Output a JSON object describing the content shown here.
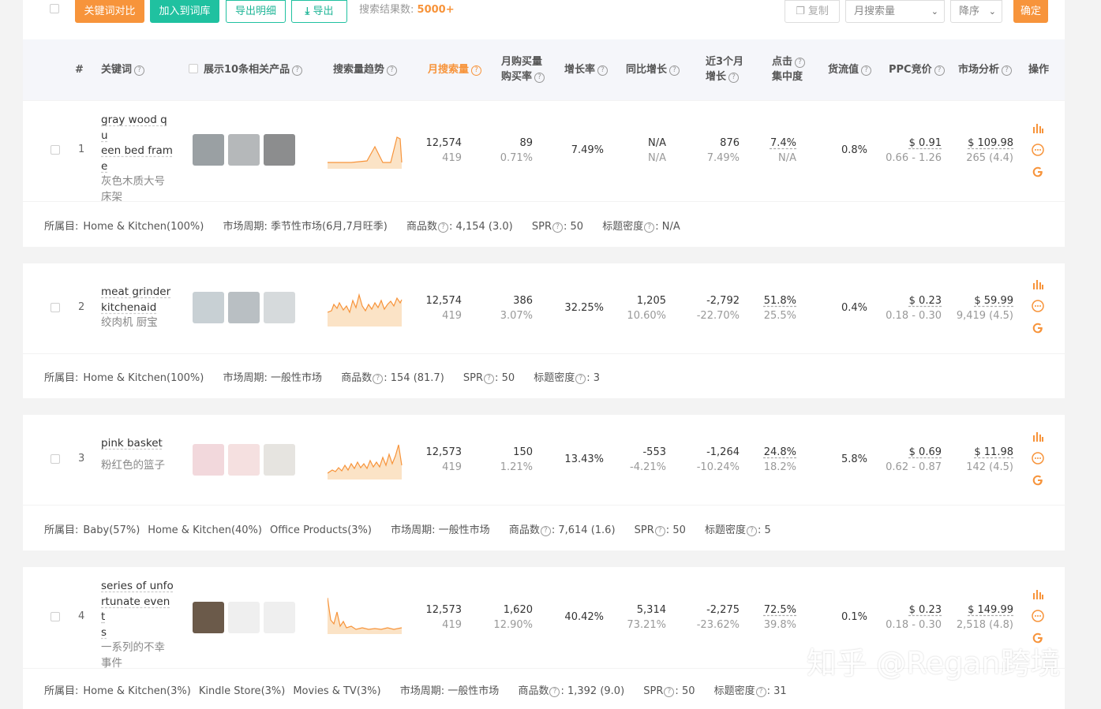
{
  "toolbar": {
    "compare_label": "关键词对比",
    "add_label": "加入到词库",
    "export_detail_label": "导出明细",
    "export_label": "导出",
    "result_prefix": "搜索结果数:",
    "result_count": "5000+",
    "copy_label": "复制",
    "sort_field": "月搜索量",
    "sort_order": "降序",
    "confirm_label": "确定"
  },
  "columns": {
    "index": "#",
    "keyword": "关键词",
    "show_products": "展示10条相关产品",
    "trend": "搜索量趋势",
    "monthly_search": "月搜索量",
    "monthly_buy_1": "月购买量",
    "monthly_buy_2": "购买率",
    "growth": "增长率",
    "yoy": "同比增长",
    "q3_1": "近3个月",
    "q3_2": "增长",
    "click_1": "点击",
    "click_2": "集中度",
    "flow": "货流值",
    "ppc": "PPC竞价",
    "market": "市场分析",
    "actions": "操作"
  },
  "meta_labels": {
    "category": "所属目:",
    "cycle": "市场周期:",
    "products": "商品数",
    "spr": "SPR",
    "title_density": "标题密度"
  },
  "rows": [
    {
      "index": "1",
      "kw_lines": [
        "gray wood qu",
        "een bed fram",
        "e"
      ],
      "cn_lines": [
        "灰色木质大号",
        "床架"
      ],
      "search": "12,574",
      "search_rank": "419",
      "buy": "89",
      "buy_rate": "0.71%",
      "growth": "7.49%",
      "yoy": "N/A",
      "yoy_sub": "N/A",
      "q3": "876",
      "q3_sub": "7.49%",
      "click": "7.4%",
      "click_sub": "N/A",
      "flow": "0.8%",
      "ppc": "$ 0.91",
      "ppc_range": "0.66 - 1.26",
      "market": "$ 109.98",
      "market_sub": "265 (4.4)",
      "categories": [
        {
          "name": "Home & Kitchen",
          "pct": "(100%)"
        }
      ],
      "cycle": "季节性市场",
      "cycle_note": "(6月,7月旺季)",
      "products": "4,154",
      "products_note": "(3.0)",
      "spr": "50",
      "density": "N/A"
    },
    {
      "index": "2",
      "kw_lines": [
        "meat grinder",
        "kitchenaid"
      ],
      "cn_lines": [
        "绞肉机 厨宝"
      ],
      "search": "12,574",
      "search_rank": "419",
      "buy": "386",
      "buy_rate": "3.07%",
      "growth": "32.25%",
      "yoy": "1,205",
      "yoy_sub": "10.60%",
      "q3": "-2,792",
      "q3_sub": "-22.70%",
      "click": "51.8%",
      "click_sub": "25.5%",
      "flow": "0.4%",
      "ppc": "$ 0.23",
      "ppc_range": "0.18 - 0.30",
      "market": "$ 59.99",
      "market_sub": "9,419 (4.5)",
      "categories": [
        {
          "name": "Home & Kitchen",
          "pct": "(100%)"
        }
      ],
      "cycle": "一般性市场",
      "cycle_note": "",
      "products": "154",
      "products_note": "(81.7)",
      "spr": "50",
      "density": "3"
    },
    {
      "index": "3",
      "kw_lines": [
        "pink basket"
      ],
      "cn_lines": [
        "粉红色的篮子"
      ],
      "search": "12,573",
      "search_rank": "419",
      "buy": "150",
      "buy_rate": "1.21%",
      "growth": "13.43%",
      "yoy": "-553",
      "yoy_sub": "-4.21%",
      "q3": "-1,264",
      "q3_sub": "-10.24%",
      "click": "24.8%",
      "click_sub": "18.2%",
      "flow": "5.8%",
      "ppc": "$ 0.69",
      "ppc_range": "0.62 - 0.87",
      "market": "$ 11.98",
      "market_sub": "142 (4.5)",
      "categories": [
        {
          "name": "Baby",
          "pct": "(57%)"
        },
        {
          "name": "Home & Kitchen",
          "pct": "(40%)"
        },
        {
          "name": "Office Products",
          "pct": "(3%)"
        }
      ],
      "cycle": "一般性市场",
      "cycle_note": "",
      "products": "7,614",
      "products_note": "(1.6)",
      "spr": "50",
      "density": "5"
    },
    {
      "index": "4",
      "kw_lines": [
        "series of unfo",
        "rtunate event",
        "s"
      ],
      "cn_lines": [
        "一系列的不幸",
        "事件"
      ],
      "search": "12,573",
      "search_rank": "419",
      "buy": "1,620",
      "buy_rate": "12.90%",
      "growth": "40.42%",
      "yoy": "5,314",
      "yoy_sub": "73.21%",
      "q3": "-2,275",
      "q3_sub": "-23.62%",
      "click": "72.5%",
      "click_sub": "39.8%",
      "flow": "0.1%",
      "ppc": "$ 0.23",
      "ppc_range": "0.18 - 0.30",
      "market": "$ 149.99",
      "market_sub": "2,518 (4.8)",
      "categories": [
        {
          "name": "Home & Kitchen",
          "pct": "(3%)"
        },
        {
          "name": "Kindle Store",
          "pct": "(3%)"
        },
        {
          "name": "Movies & TV",
          "pct": "(3%)"
        }
      ],
      "cycle": "一般性市场",
      "cycle_note": "",
      "products": "1,392",
      "products_note": "(9.0)",
      "spr": "50",
      "density": "31"
    }
  ],
  "watermark": "知乎 @Regan跨境",
  "colors": {
    "accent": "#f7943b",
    "teal": "#20c1a0",
    "trend_fill": "#fbe3c6"
  }
}
